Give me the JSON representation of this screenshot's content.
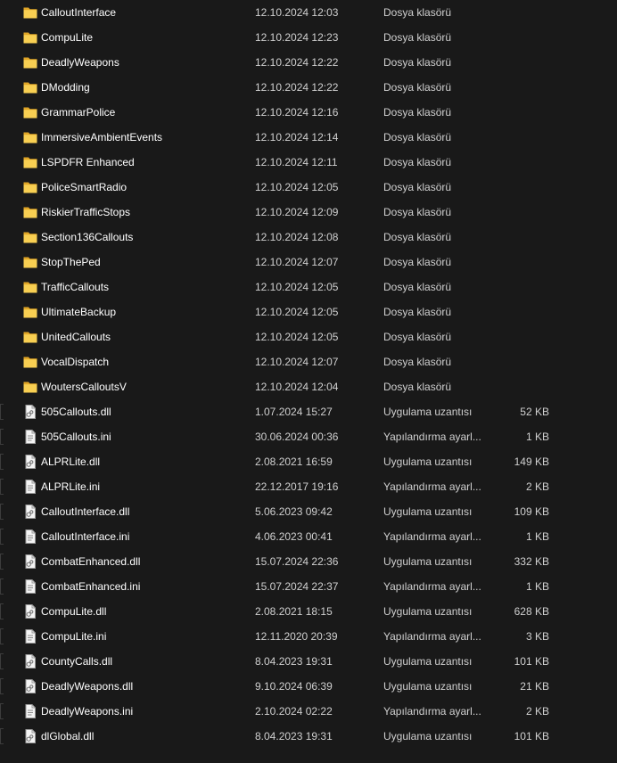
{
  "rows": [
    {
      "name": "CalloutInterface",
      "date": "12.10.2024 12:03",
      "type": "Dosya klasörü",
      "size": "",
      "icon": "folder-icon"
    },
    {
      "name": "CompuLite",
      "date": "12.10.2024 12:23",
      "type": "Dosya klasörü",
      "size": "",
      "icon": "folder-icon"
    },
    {
      "name": "DeadlyWeapons",
      "date": "12.10.2024 12:22",
      "type": "Dosya klasörü",
      "size": "",
      "icon": "folder-icon"
    },
    {
      "name": "DModding",
      "date": "12.10.2024 12:22",
      "type": "Dosya klasörü",
      "size": "",
      "icon": "folder-icon"
    },
    {
      "name": "GrammarPolice",
      "date": "12.10.2024 12:16",
      "type": "Dosya klasörü",
      "size": "",
      "icon": "folder-icon"
    },
    {
      "name": "ImmersiveAmbientEvents",
      "date": "12.10.2024 12:14",
      "type": "Dosya klasörü",
      "size": "",
      "icon": "folder-icon"
    },
    {
      "name": "LSPDFR Enhanced",
      "date": "12.10.2024 12:11",
      "type": "Dosya klasörü",
      "size": "",
      "icon": "folder-icon"
    },
    {
      "name": "PoliceSmartRadio",
      "date": "12.10.2024 12:05",
      "type": "Dosya klasörü",
      "size": "",
      "icon": "folder-icon"
    },
    {
      "name": "RiskierTrafficStops",
      "date": "12.10.2024 12:09",
      "type": "Dosya klasörü",
      "size": "",
      "icon": "folder-icon"
    },
    {
      "name": "Section136Callouts",
      "date": "12.10.2024 12:08",
      "type": "Dosya klasörü",
      "size": "",
      "icon": "folder-icon"
    },
    {
      "name": "StopThePed",
      "date": "12.10.2024 12:07",
      "type": "Dosya klasörü",
      "size": "",
      "icon": "folder-icon"
    },
    {
      "name": "TrafficCallouts",
      "date": "12.10.2024 12:05",
      "type": "Dosya klasörü",
      "size": "",
      "icon": "folder-icon"
    },
    {
      "name": "UltimateBackup",
      "date": "12.10.2024 12:05",
      "type": "Dosya klasörü",
      "size": "",
      "icon": "folder-icon"
    },
    {
      "name": "UnitedCallouts",
      "date": "12.10.2024 12:05",
      "type": "Dosya klasörü",
      "size": "",
      "icon": "folder-icon"
    },
    {
      "name": "VocalDispatch",
      "date": "12.10.2024 12:07",
      "type": "Dosya klasörü",
      "size": "",
      "icon": "folder-icon"
    },
    {
      "name": "WoutersCalloutsV",
      "date": "12.10.2024 12:04",
      "type": "Dosya klasörü",
      "size": "",
      "icon": "folder-icon"
    },
    {
      "name": "505Callouts.dll",
      "date": "1.07.2024 15:27",
      "type": "Uygulama uzantısı",
      "size": "52 KB",
      "icon": "dll-file-icon"
    },
    {
      "name": "505Callouts.ini",
      "date": "30.06.2024 00:36",
      "type": "Yapılandırma ayarl...",
      "size": "1 KB",
      "icon": "ini-file-icon"
    },
    {
      "name": "ALPRLite.dll",
      "date": "2.08.2021 16:59",
      "type": "Uygulama uzantısı",
      "size": "149 KB",
      "icon": "dll-file-icon"
    },
    {
      "name": "ALPRLite.ini",
      "date": "22.12.2017 19:16",
      "type": "Yapılandırma ayarl...",
      "size": "2 KB",
      "icon": "ini-file-icon"
    },
    {
      "name": "CalloutInterface.dll",
      "date": "5.06.2023 09:42",
      "type": "Uygulama uzantısı",
      "size": "109 KB",
      "icon": "dll-file-icon"
    },
    {
      "name": "CalloutInterface.ini",
      "date": "4.06.2023 00:41",
      "type": "Yapılandırma ayarl...",
      "size": "1 KB",
      "icon": "ini-file-icon"
    },
    {
      "name": "CombatEnhanced.dll",
      "date": "15.07.2024 22:36",
      "type": "Uygulama uzantısı",
      "size": "332 KB",
      "icon": "dll-file-icon"
    },
    {
      "name": "CombatEnhanced.ini",
      "date": "15.07.2024 22:37",
      "type": "Yapılandırma ayarl...",
      "size": "1 KB",
      "icon": "ini-file-icon"
    },
    {
      "name": "CompuLite.dll",
      "date": "2.08.2021 18:15",
      "type": "Uygulama uzantısı",
      "size": "628 KB",
      "icon": "dll-file-icon"
    },
    {
      "name": "CompuLite.ini",
      "date": "12.11.2020 20:39",
      "type": "Yapılandırma ayarl...",
      "size": "3 KB",
      "icon": "ini-file-icon"
    },
    {
      "name": "CountyCalls.dll",
      "date": "8.04.2023 19:31",
      "type": "Uygulama uzantısı",
      "size": "101 KB",
      "icon": "dll-file-icon"
    },
    {
      "name": "DeadlyWeapons.dll",
      "date": "9.10.2024 06:39",
      "type": "Uygulama uzantısı",
      "size": "21 KB",
      "icon": "dll-file-icon"
    },
    {
      "name": "DeadlyWeapons.ini",
      "date": "2.10.2024 02:22",
      "type": "Yapılandırma ayarl...",
      "size": "2 KB",
      "icon": "ini-file-icon"
    },
    {
      "name": "dlGlobal.dll",
      "date": "8.04.2023 19:31",
      "type": "Uygulama uzantısı",
      "size": "101 KB",
      "icon": "dll-file-icon"
    }
  ]
}
